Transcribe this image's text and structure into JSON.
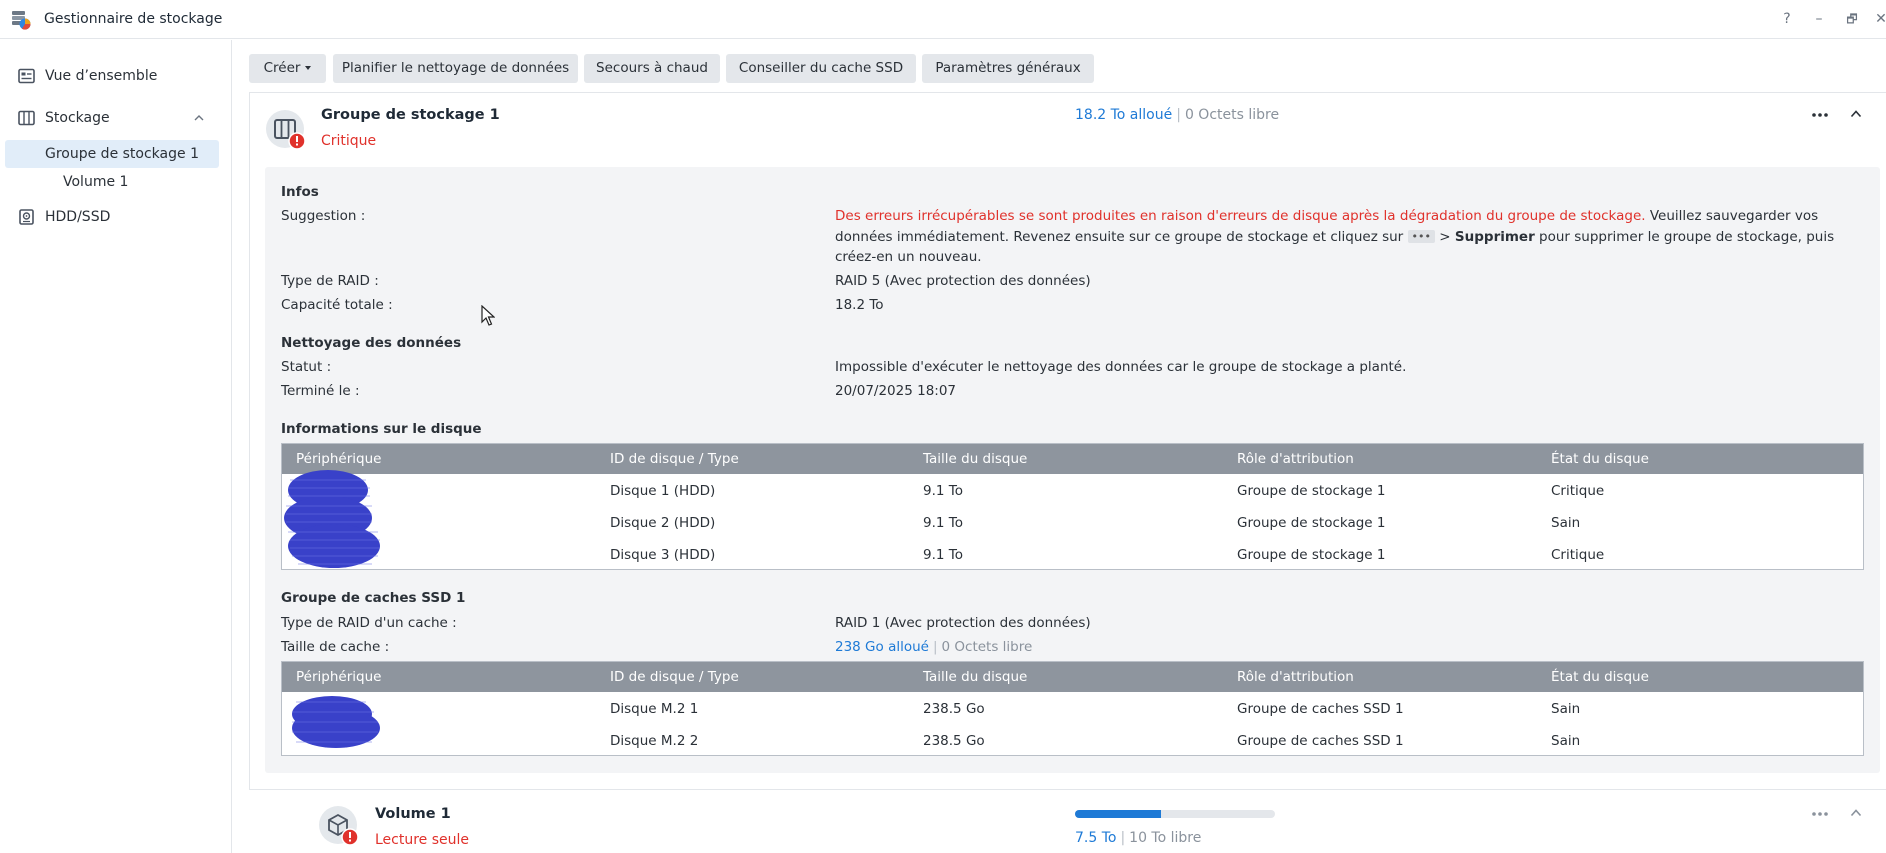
{
  "window": {
    "title": "Gestionnaire de stockage",
    "help": "?",
    "minimize": "–",
    "restore": "🗗",
    "close": "✕"
  },
  "sidebar": {
    "overview": "Vue d’ensemble",
    "storage": "Stockage",
    "pool": "Groupe de stockage 1",
    "volume": "Volume 1",
    "hdd": "HDD/SSD"
  },
  "toolbar": {
    "create": "Créer",
    "scrub": "Planifier le nettoyage de données",
    "hotspare": "Secours à chaud",
    "ssd_advisor": "Conseiller du cache SSD",
    "settings": "Paramètres généraux"
  },
  "pool": {
    "title": "Groupe de stockage 1",
    "status": "Critique",
    "allocated": "18.2 To alloué",
    "separator": "|",
    "free": "0 Octets libre",
    "info": {
      "section": "Infos",
      "suggestion_label": "Suggestion :",
      "suggestion_red": "Des erreurs irrécupérables se sont produites en raison d'erreurs de disque après la dégradation du groupe de stockage.",
      "suggestion_1": " Veuillez sauvegarder vos données immédiatement. Revenez ensuite sur ce groupe de stockage et cliquez sur ",
      "suggestion_dots": "•••",
      "suggestion_2": " > ",
      "suggestion_bold": "Supprimer",
      "suggestion_3": " pour supprimer le groupe de stockage, puis créez-en un nouveau.",
      "raid_label": "Type de RAID :",
      "raid_value": "RAID 5 (Avec protection des données)",
      "capacity_label": "Capacité totale :",
      "capacity_value": "18.2 To"
    },
    "scrubbing": {
      "section": "Nettoyage des données",
      "status_label": "Statut :",
      "status_value": "Impossible d'exécuter le nettoyage des données car le groupe de stockage a planté.",
      "finished_label": "Terminé le :",
      "finished_value": "20/07/2025 18:07"
    },
    "disks": {
      "section": "Informations sur le disque",
      "headers": [
        "Périphérique",
        "ID de disque / Type",
        "Taille du disque",
        "Rôle d'attribution",
        "État du disque"
      ],
      "rows": [
        {
          "id": "Disque 1 (HDD)",
          "size": "9.1 To",
          "role": "Groupe de stockage 1",
          "state": "Critique"
        },
        {
          "id": "Disque 2 (HDD)",
          "size": "9.1 To",
          "role": "Groupe de stockage 1",
          "state": "Sain"
        },
        {
          "id": "Disque 3 (HDD)",
          "size": "9.1 To",
          "role": "Groupe de stockage 1",
          "state": "Critique"
        }
      ]
    },
    "cache": {
      "section": "Groupe de caches SSD 1",
      "raid_label": "Type de RAID d'un cache :",
      "raid_value": "RAID 1 (Avec protection des données)",
      "size_label": "Taille de cache :",
      "allocated": "238 Go alloué",
      "free": "0 Octets libre",
      "headers": [
        "Périphérique",
        "ID de disque / Type",
        "Taille du disque",
        "Rôle d'attribution",
        "État du disque"
      ],
      "rows": [
        {
          "id": "Disque M.2 1",
          "size": "238.5 Go",
          "role": "Groupe de caches SSD 1",
          "state": "Sain"
        },
        {
          "id": "Disque M.2 2",
          "size": "238.5 Go",
          "role": "Groupe de caches SSD 1",
          "state": "Sain"
        }
      ]
    }
  },
  "volume": {
    "title": "Volume 1",
    "status": "Lecture seule",
    "used": "7.5 To",
    "free": "10 To libre",
    "used_fraction": 0.43
  },
  "colors": {
    "critical": "#e0312b",
    "healthy": "#13a338",
    "accent": "#1e7ad6"
  }
}
